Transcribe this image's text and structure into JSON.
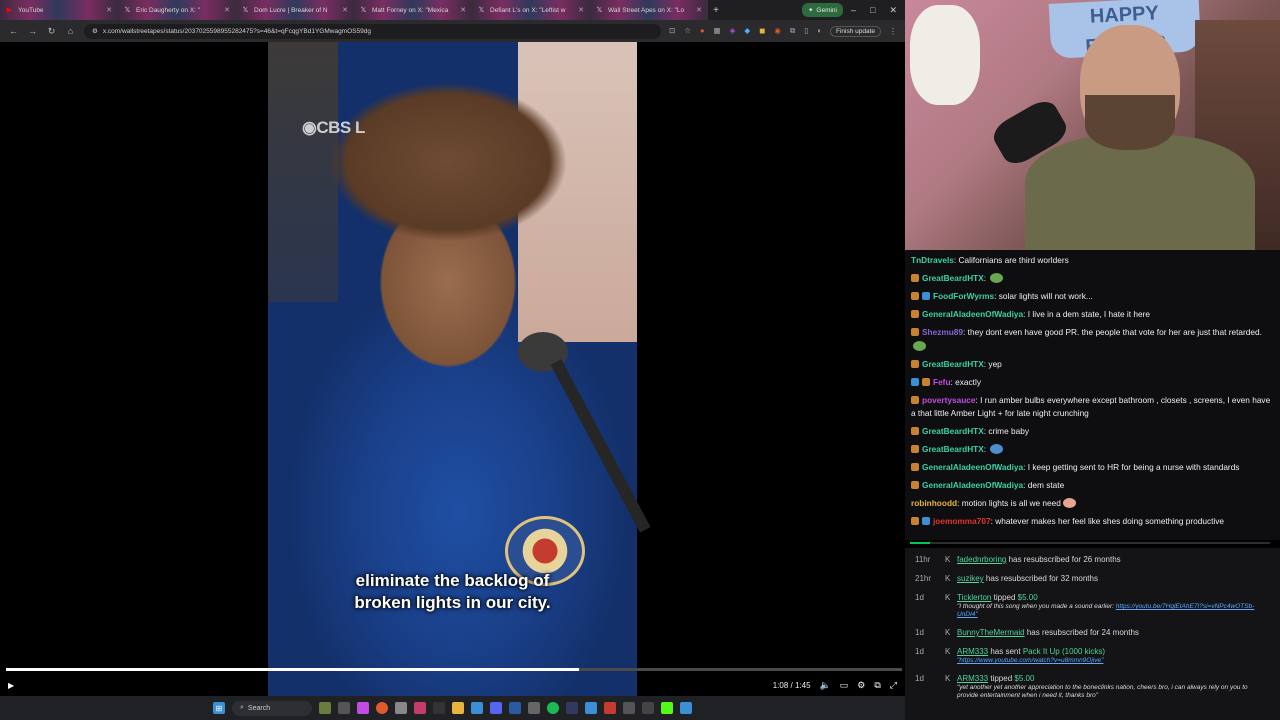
{
  "browser": {
    "tabs": [
      {
        "icon": "youtube-icon",
        "label": "YouTube",
        "color": "#ff0000"
      },
      {
        "icon": "x-icon",
        "label": "Eric Daugherty on X: \"",
        "color": "#ffffff"
      },
      {
        "icon": "x-icon",
        "label": "Dom Lucre | Breaker of N",
        "color": "#ffffff"
      },
      {
        "icon": "x-icon",
        "label": "Matt Forney on X: \"Mexica",
        "color": "#ffffff"
      },
      {
        "icon": "x-icon",
        "label": "Defiant L's on X: \"Leftist w",
        "color": "#ffffff"
      },
      {
        "icon": "x-icon",
        "label": "Wall Street Apes on X: \"Lo",
        "color": "#ffffff"
      }
    ],
    "gemini_label": "Gemini",
    "url": "x.com/wallstreetapes/status/2037025598955282475?s=46&t=qFcqgYBd1YGMwagmOS59dg",
    "finish_update_label": "Finish update"
  },
  "video": {
    "watermark": "CBS L",
    "caption_line1": "eliminate the backlog of",
    "caption_line2": "broken lights in our city.",
    "progress": 0.64,
    "time": "1:08 / 1:45"
  },
  "taskbar": {
    "search_label": "Search"
  },
  "webcam": {
    "banner": "HAPPY EASTER"
  },
  "chat": {
    "messages": [
      {
        "user": "TnDtravels",
        "color": "#3ad1a7",
        "text": "Californians are third worlders",
        "badges": []
      },
      {
        "user": "GreatBeardHTX",
        "color": "#3ad1a7",
        "text": "",
        "badges": [
          "#c9822f"
        ],
        "emote": "#6aa84f"
      },
      {
        "user": "FoodForWyrms",
        "color": "#3ad1a7",
        "text": "solar lights will not work...",
        "badges": [
          "#c9822f",
          "#3a8fd6"
        ]
      },
      {
        "user": "GeneralAladeenOfWadiya",
        "color": "#3ad1a7",
        "text": "I live in a dem state, I hate it here",
        "badges": [
          "#c9822f"
        ]
      },
      {
        "user": "Shezmu89",
        "color": "#8a63d2",
        "text": "they dont even have good PR. the people that vote for her are just that retarded.",
        "badges": [
          "#c9822f"
        ],
        "emote": "#6aa84f"
      },
      {
        "user": "GreatBeardHTX",
        "color": "#3ad1a7",
        "text": "yep",
        "badges": [
          "#c9822f"
        ]
      },
      {
        "user": "Fefu",
        "color": "#c04de3",
        "text": "exactly",
        "badges": [
          "#3a8fd6",
          "#c9822f"
        ]
      },
      {
        "user": "povertysauce",
        "color": "#c04de3",
        "text": "I run amber bulbs everywhere except bathroom , closets , screens, I even have a that little Amber Light + for late night crunching",
        "badges": [
          "#c9822f"
        ]
      },
      {
        "user": "GreatBeardHTX",
        "color": "#3ad1a7",
        "text": "crime baby",
        "badges": [
          "#c9822f"
        ]
      },
      {
        "user": "GreatBeardHTX",
        "color": "#3ad1a7",
        "text": "",
        "badges": [
          "#c9822f"
        ],
        "emote": "#4a8fd0"
      },
      {
        "user": "GeneralAladeenOfWadiya",
        "color": "#3ad1a7",
        "text": "I keep getting sent to HR for being a nurse with standards",
        "badges": [
          "#c9822f"
        ]
      },
      {
        "user": "GeneralAladeenOfWadiya",
        "color": "#3ad1a7",
        "text": "dem state",
        "badges": [
          "#c9822f"
        ]
      },
      {
        "user": "robinhoodd",
        "color": "#e8b53c",
        "text": "motion lights is all we need",
        "badges": [],
        "emote": "#e9a58f"
      },
      {
        "user": "joemomma707",
        "color": "#e0342b",
        "text": "whatever makes her feel like shes doing something productive",
        "badges": [
          "#c9822f",
          "#3a8fd6"
        ]
      }
    ]
  },
  "feed": {
    "events": [
      {
        "age": "11hr",
        "name": "fadednrboring",
        "action": "has resubscribed for 26 months",
        "amount": "",
        "message": "",
        "link": ""
      },
      {
        "age": "21hr",
        "name": "suzikey",
        "action": "has resubscribed for 32 months",
        "amount": "",
        "message": "",
        "link": ""
      },
      {
        "age": "1d",
        "name": "Ticklerton",
        "action": "tipped",
        "amount": "$5.00",
        "message": "\"I thought of this song when you made a sound earlier:",
        "link": "https://youtu.be/7HqlEtAhE7I?si=vNPc4wOTSb-UnDI4\""
      },
      {
        "age": "1d",
        "name": "BunnyTheMermaid",
        "action": "has resubscribed for 24 months",
        "amount": "",
        "message": "",
        "link": ""
      },
      {
        "age": "1d",
        "name": "ARM333",
        "action": "has sent",
        "amount": "Pack It Up (1000 kicks)",
        "message": "",
        "link": "\"https://www.youtube.com/watch?v=u8mmn9Ojive\""
      },
      {
        "age": "1d",
        "name": "ARM333",
        "action": "tipped",
        "amount": "$5.00",
        "message": "\"yet another yet another appreciation to the boneclinks nation, cheers bro, i can always rely on you to provide entertainment when i need it, thanks bro\"",
        "link": ""
      }
    ]
  }
}
